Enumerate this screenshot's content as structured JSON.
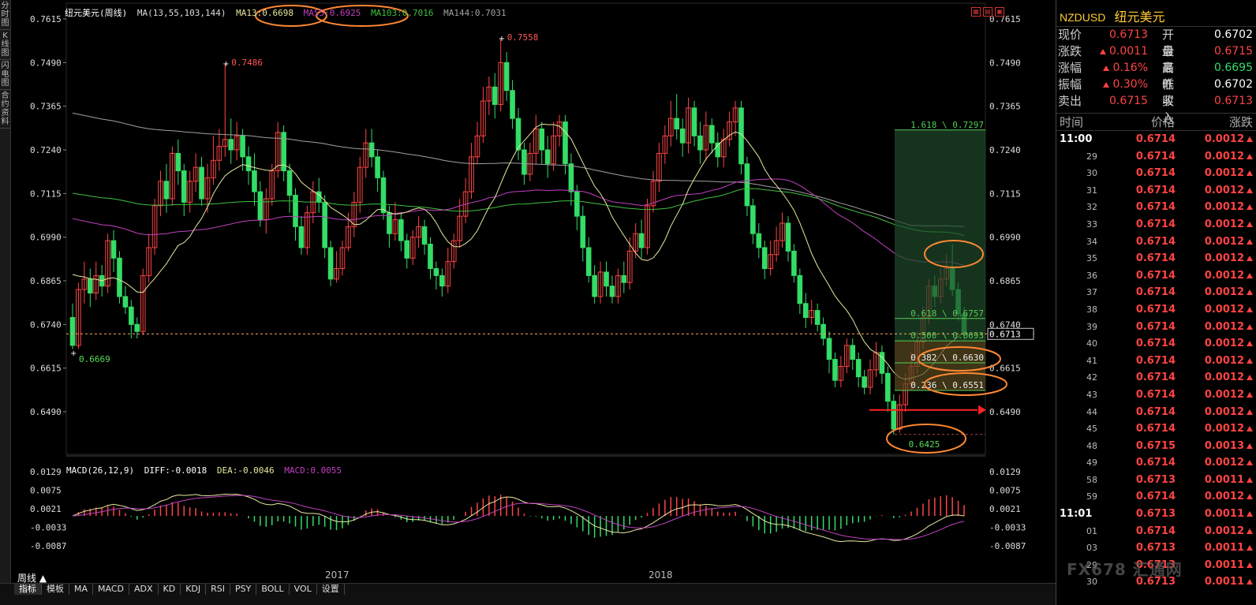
{
  "left_tabs": [
    "分时图",
    "K线图",
    "闪电图",
    "合约资料"
  ],
  "legend": {
    "title": "纽元美元(周线)",
    "ma": "MA(13,55,103,144)",
    "ma13": "MA13:0.6698",
    "ma55": "MA55:0.6925",
    "ma103": "MA103:0.7016",
    "ma144": "MA144:0.7031"
  },
  "macd_legend": {
    "title": "MACD(26,12,9)",
    "diff": "DIFF:-0.0018",
    "dea": "DEA:-0.0046",
    "macd": "MACD:0.0055"
  },
  "colors": {
    "up": "#ff4444",
    "down": "#33dd66",
    "ma13": "#e8e8a0",
    "ma55": "#c040c0",
    "ma103": "#40c040",
    "ma144": "#a0a0a0",
    "fib": "#55cc55",
    "circle": "#ff8833",
    "arrow": "#ff2222"
  },
  "price_axis": [
    "0.7615",
    "0.7490",
    "0.7365",
    "0.7240",
    "0.7115",
    "0.6990",
    "0.6865",
    "0.6740",
    "0.6615",
    "0.6490"
  ],
  "macd_axis": [
    "0.0129",
    "0.0075",
    "0.0021",
    "-0.0033",
    "-0.0087"
  ],
  "annotations": {
    "high1": "0.7486",
    "high2": "0.7558",
    "low1": "0.6669",
    "low2": "0.6425",
    "last_price": "0.6713"
  },
  "fib_levels": [
    "1.618 \\ 0.7297",
    "0.618 \\ 0.6757",
    "0.500 \\ 0.6693",
    "0.382 \\ 0.6630",
    "0.236 \\ 0.6551"
  ],
  "year_labels": [
    "2017",
    "2018"
  ],
  "bottom": {
    "period": "周线 ▲",
    "tabs": [
      "指标",
      "模板",
      "MA",
      "MACD",
      "ADX",
      "KD",
      "KDJ",
      "RSI",
      "PSY",
      "BOLL",
      "VOL",
      "设置"
    ]
  },
  "top_icons": [
    "grid-icon",
    "chart-icon",
    "window-icon"
  ],
  "panel": {
    "symbol": "NZDUSD",
    "name": "纽元美元",
    "quote": [
      {
        "k1": "现价",
        "v1": "0.6713",
        "c1": "up",
        "k2": "开盘",
        "v2": "0.6702",
        "c2": "wh"
      },
      {
        "k1": "涨跌",
        "v1": "0.0011",
        "c1": "up",
        "arrow1": true,
        "k2": "最高",
        "v2": "0.6715",
        "c2": "up"
      },
      {
        "k1": "涨幅",
        "v1": "0.16%",
        "c1": "up",
        "arrow1": true,
        "k2": "最低",
        "v2": "0.6695",
        "c2": "dn"
      },
      {
        "k1": "振幅",
        "v1": "0.30%",
        "c1": "up",
        "arrow1": true,
        "k2": "昨收",
        "v2": "0.6702",
        "c2": "wh"
      },
      {
        "k1": "卖出",
        "v1": "0.6715",
        "c1": "up",
        "k2": "买入",
        "v2": "0.6713",
        "c2": "up"
      }
    ],
    "tick_headers": [
      "时间",
      "价格",
      "涨跌"
    ],
    "ticks": [
      {
        "t": "11:00",
        "big": true,
        "p": "0.6714",
        "c": "0.0012"
      },
      {
        "t": "29",
        "p": "0.6714",
        "c": "0.0012"
      },
      {
        "t": "30",
        "p": "0.6714",
        "c": "0.0012"
      },
      {
        "t": "31",
        "p": "0.6714",
        "c": "0.0012"
      },
      {
        "t": "32",
        "p": "0.6714",
        "c": "0.0012"
      },
      {
        "t": "33",
        "p": "0.6714",
        "c": "0.0012"
      },
      {
        "t": "34",
        "p": "0.6714",
        "c": "0.0012"
      },
      {
        "t": "35",
        "p": "0.6714",
        "c": "0.0012"
      },
      {
        "t": "36",
        "p": "0.6714",
        "c": "0.0012"
      },
      {
        "t": "37",
        "p": "0.6714",
        "c": "0.0012"
      },
      {
        "t": "38",
        "p": "0.6714",
        "c": "0.0012"
      },
      {
        "t": "39",
        "p": "0.6714",
        "c": "0.0012"
      },
      {
        "t": "40",
        "p": "0.6714",
        "c": "0.0012"
      },
      {
        "t": "41",
        "p": "0.6714",
        "c": "0.0012"
      },
      {
        "t": "42",
        "p": "0.6714",
        "c": "0.0012"
      },
      {
        "t": "43",
        "p": "0.6714",
        "c": "0.0012"
      },
      {
        "t": "44",
        "p": "0.6714",
        "c": "0.0012"
      },
      {
        "t": "45",
        "p": "0.6714",
        "c": "0.0012"
      },
      {
        "t": "48",
        "p": "0.6715",
        "c": "0.0013"
      },
      {
        "t": "49",
        "p": "0.6714",
        "c": "0.0012"
      },
      {
        "t": "58",
        "p": "0.6713",
        "c": "0.0011"
      },
      {
        "t": "59",
        "p": "0.6714",
        "c": "0.0012"
      },
      {
        "t": "11:01",
        "big": true,
        "p": "0.6713",
        "c": "0.0011"
      },
      {
        "t": "01",
        "p": "0.6714",
        "c": "0.0012"
      },
      {
        "t": "03",
        "p": "0.6713",
        "c": "0.0011"
      },
      {
        "t": "29",
        "p": "0.6713",
        "c": "0.0011"
      },
      {
        "t": "30",
        "p": "0.6713",
        "c": "0.0011"
      }
    ],
    "watermark": "FX678 汇通网"
  }
}
